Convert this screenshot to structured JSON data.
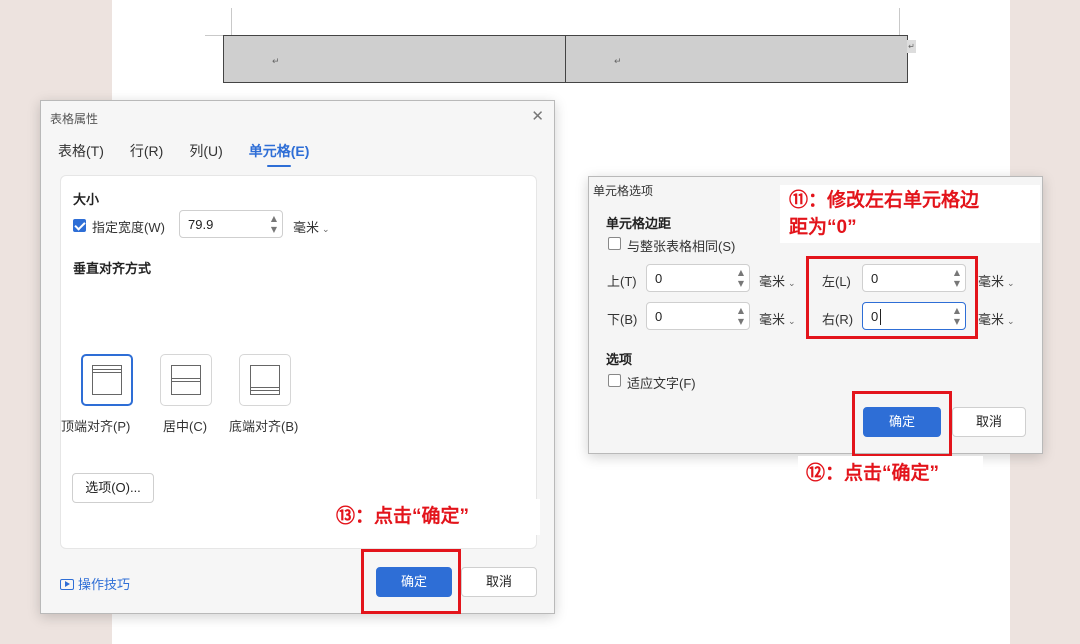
{
  "document": {
    "cell_marks": [
      "↵",
      "↵"
    ],
    "row_end_mark": "↵"
  },
  "table_props_dialog": {
    "title": "表格属性",
    "close": "✕",
    "tabs": [
      "表格(T)",
      "行(R)",
      "列(U)",
      "单元格(E)"
    ],
    "active_tab": "单元格(E)",
    "size_section": {
      "title": "大小",
      "specify_width_label": "指定宽度(W)",
      "specify_width_checked": true,
      "width_value": "79.9",
      "unit": "毫米"
    },
    "vertical_align_section": {
      "title": "垂直对齐方式",
      "options": [
        "顶端对齐(P)",
        "居中(C)",
        "底端对齐(B)"
      ],
      "selected": "顶端对齐(P)"
    },
    "options_button": "选项(O)...",
    "tips_link": "操作技巧",
    "ok_button": "确定",
    "cancel_button": "取消"
  },
  "cell_options_dialog": {
    "title": "单元格选项",
    "margins_section": {
      "title": "单元格边距",
      "same_as_table_label": "与整张表格相同(S)",
      "same_as_table_checked": false,
      "top_label": "上(T)",
      "top_value": "0",
      "top_unit": "毫米",
      "bottom_label": "下(B)",
      "bottom_value": "0",
      "bottom_unit": "毫米",
      "left_label": "左(L)",
      "left_value": "0",
      "left_unit": "毫米",
      "right_label": "右(R)",
      "right_value": "0",
      "right_unit": "毫米"
    },
    "options_section": {
      "title": "选项",
      "fit_text_label": "适应文字(F)",
      "fit_text_checked": false
    },
    "ok_button": "确定",
    "cancel_button": "取消"
  },
  "annotations": {
    "step11_line1": "⑪：修改左右单元格边",
    "step11_line2": "距为“0”",
    "step12": "⑫：点击“确定”",
    "step13": "⑬：点击“确定”",
    "highlight_color": "#e3141b"
  },
  "colors": {
    "accent": "#2e6ed6",
    "table_fill": "#cfcfcf"
  }
}
